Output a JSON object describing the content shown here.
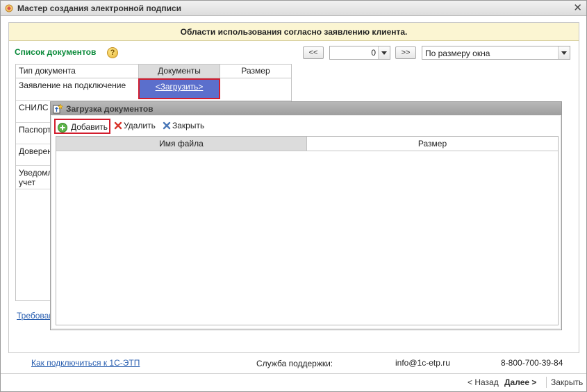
{
  "window": {
    "title": "Мастер создания электронной подписи",
    "close_glyph": "✕"
  },
  "banner": {
    "text": "Области использования согласно заявлению клиента."
  },
  "doc_list": {
    "title": "Список документов",
    "help_glyph": "?",
    "pager": {
      "prev": "<<",
      "page": "0",
      "next": ">>",
      "zoom": "По размеру окна"
    },
    "columns": [
      "Тип документа",
      "Документы",
      "Размер"
    ],
    "rows": [
      {
        "name": "Заявление на подключение",
        "upload": "<Загрузить>"
      },
      {
        "name": "СНИЛС"
      },
      {
        "name": "Паспорт"
      },
      {
        "name": "Доверен"
      },
      {
        "name": "Уведомл\nучет"
      }
    ],
    "requirements_link": "Требован"
  },
  "upload_dialog": {
    "title": "Загрузка документов",
    "toolbar": {
      "add": "Добавить",
      "delete": "Удалить",
      "close": "Закрыть"
    },
    "columns": [
      "Имя файла",
      "Размер"
    ]
  },
  "footer": {
    "how_to_link": "Как подключиться к 1С-ЭТП",
    "support_label": "Служба поддержки:",
    "email": "info@1c-etp.ru",
    "phone": "8-800-700-39-84"
  },
  "nav": {
    "back": "< Назад",
    "next": "Далее >",
    "close": "Закрыть"
  },
  "colors": {
    "accent_green": "#0a8a3a",
    "link_blue": "#2a5fb0",
    "highlight_red": "#d21d2d",
    "upload_cell": "#5b6fcc",
    "banner_bg": "#fbf5d2"
  }
}
